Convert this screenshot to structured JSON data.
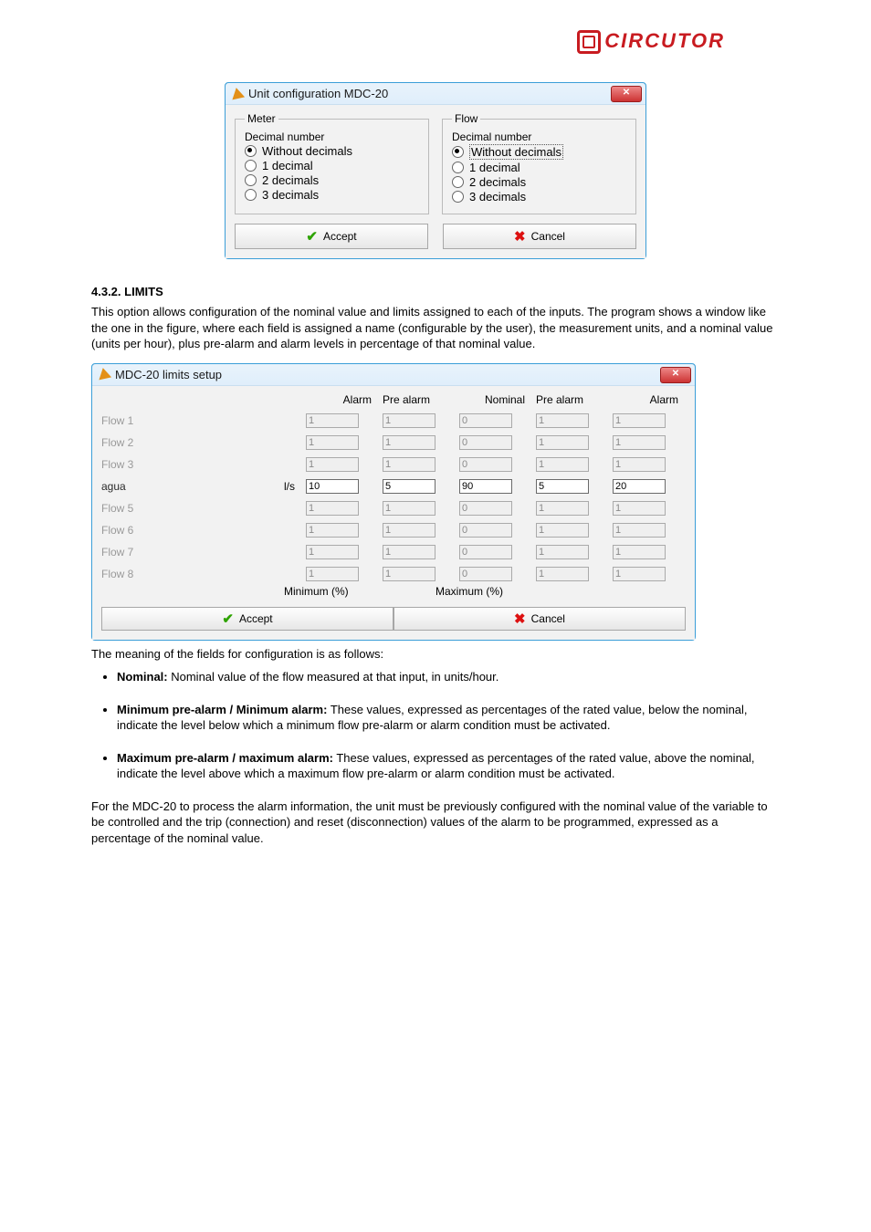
{
  "brand": "CIRCUTOR",
  "dlg1": {
    "title": "Unit configuration MDC-20",
    "close": "✕",
    "meter": {
      "legend": "Meter",
      "heading": "Decimal number",
      "opts": [
        "Without decimals",
        "1 decimal",
        "2 decimals",
        "3 decimals"
      ],
      "selected": 0
    },
    "flow": {
      "legend": "Flow",
      "heading": "Decimal number",
      "opts": [
        "Without decimals",
        "1 decimal",
        "2 decimals",
        "3 decimals"
      ],
      "selected": 0
    },
    "accept": "Accept",
    "cancel": "Cancel"
  },
  "sec432": {
    "title": "4.3.2. LIMITS",
    "para": "This option allows configuration of the nominal value and limits assigned to each of the inputs. The program shows a window like the one in the figure, where each field is assigned a name (configurable by the user), the measurement units, and a nominal value (units per hour), plus pre-alarm and alarm levels in percentage of that nominal value."
  },
  "dlg2": {
    "title": "MDC-20 limits setup",
    "close": "✕",
    "cols": {
      "alarm1": "Alarm",
      "pre1": "Pre alarm",
      "nom": "Nominal",
      "pre2": "Pre alarm",
      "alarm2": "Alarm",
      "min": "Minimum (%)",
      "max": "Maximum (%)"
    },
    "rows": [
      {
        "name": "Flow 1",
        "unit": "",
        "a1": "1",
        "p1": "1",
        "n": "0",
        "p2": "1",
        "a2": "1",
        "dis": true
      },
      {
        "name": "Flow 2",
        "unit": "",
        "a1": "1",
        "p1": "1",
        "n": "0",
        "p2": "1",
        "a2": "1",
        "dis": true
      },
      {
        "name": "Flow 3",
        "unit": "",
        "a1": "1",
        "p1": "1",
        "n": "0",
        "p2": "1",
        "a2": "1",
        "dis": true
      },
      {
        "name": "agua",
        "unit": "l/s",
        "a1": "10",
        "p1": "5",
        "n": "90",
        "p2": "5",
        "a2": "20",
        "dis": false
      },
      {
        "name": "Flow 5",
        "unit": "",
        "a1": "1",
        "p1": "1",
        "n": "0",
        "p2": "1",
        "a2": "1",
        "dis": true
      },
      {
        "name": "Flow 6",
        "unit": "",
        "a1": "1",
        "p1": "1",
        "n": "0",
        "p2": "1",
        "a2": "1",
        "dis": true
      },
      {
        "name": "Flow 7",
        "unit": "",
        "a1": "1",
        "p1": "1",
        "n": "0",
        "p2": "1",
        "a2": "1",
        "dis": true
      },
      {
        "name": "Flow 8",
        "unit": "",
        "a1": "1",
        "p1": "1",
        "n": "0",
        "p2": "1",
        "a2": "1",
        "dis": true
      }
    ],
    "accept": "Accept",
    "cancel": "Cancel"
  },
  "after": {
    "p1": "The meaning of the fields for configuration is as follows:",
    "b1": {
      "t": "Nominal:",
      "d": " Nominal value of the flow measured at that input, in units/hour."
    },
    "b2": {
      "t": "Minimum pre-alarm / Minimum alarm:",
      "d": " These values, expressed as percentages of the rated value, below the nominal, indicate the level below which a minimum flow pre-alarm or alarm condition must be activated."
    },
    "b3": {
      "t": "Maximum pre-alarm / maximum alarm:",
      "d": " These values, expressed as percentages of the rated value, above the nominal, indicate the level above which a maximum flow pre-alarm or alarm condition must be activated."
    },
    "p2": "For the MDC-20 to process the alarm information, the unit must be previously configured with the nominal value of the variable to be controlled and the trip (connection) and reset (disconnection) values of the alarm to be programmed, expressed as a percentage of the nominal value."
  }
}
